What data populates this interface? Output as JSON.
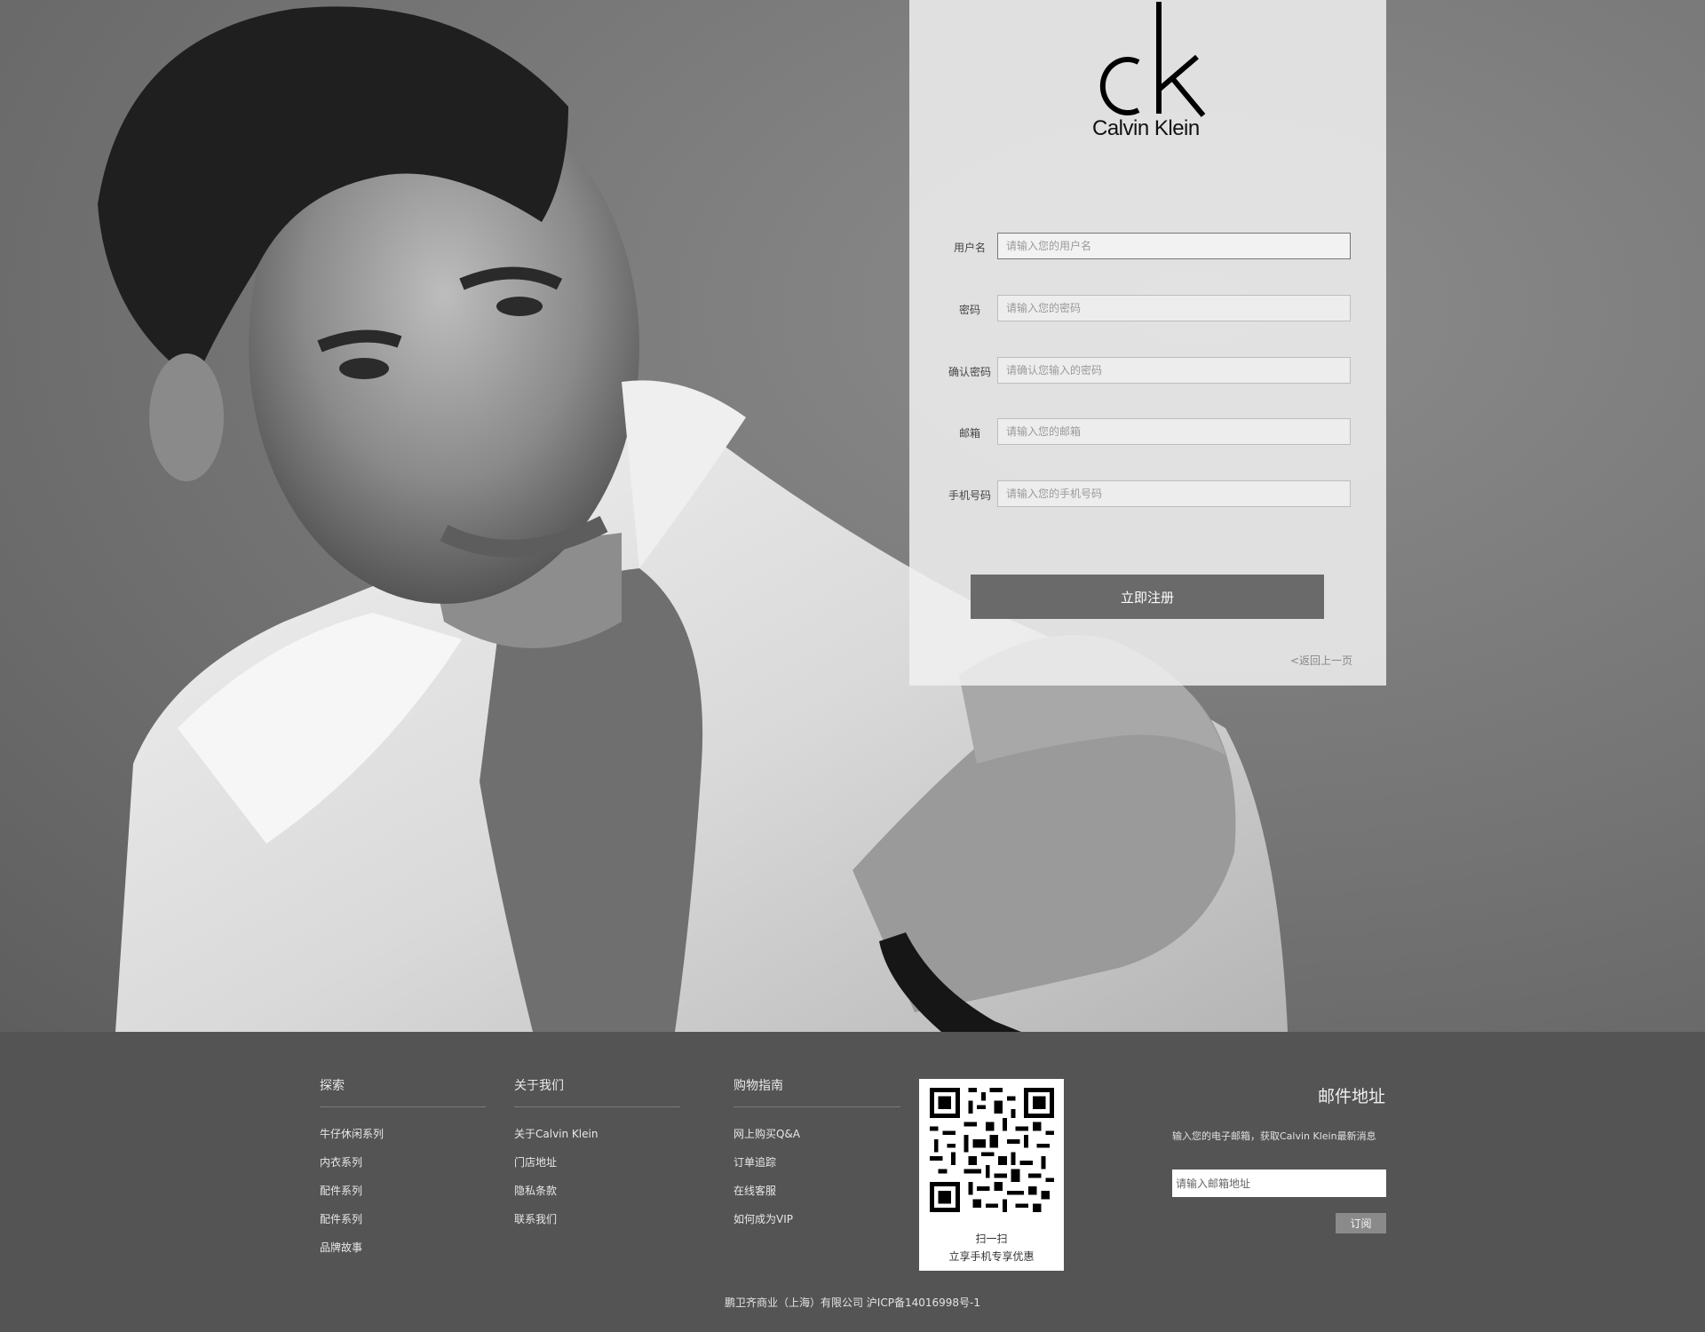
{
  "brand": {
    "logo_mark": "ck",
    "logo_text": "Calvin Klein"
  },
  "form": {
    "fields": [
      {
        "label": "用户名",
        "placeholder": "请输入您的用户名"
      },
      {
        "label": "密码",
        "placeholder": "请输入您的密码"
      },
      {
        "label": "确认密码",
        "placeholder": "请确认您输入的密码"
      },
      {
        "label": "邮箱",
        "placeholder": "请输入您的邮箱"
      },
      {
        "label": "手机号码",
        "placeholder": "请输入您的手机号码"
      }
    ],
    "submit_label": "立即注册",
    "back_label": "<返回上一页"
  },
  "footer": {
    "columns": [
      {
        "title": "探索",
        "items": [
          "牛仔休闲系列",
          "内衣系列",
          "配件系列",
          "配件系列",
          "品牌故事"
        ]
      },
      {
        "title": "关于我们",
        "items": [
          "关于Calvin Klein",
          "门店地址",
          "隐私条款",
          "联系我们"
        ]
      },
      {
        "title": "购物指南",
        "items": [
          "网上购买Q&A",
          "订单追踪",
          "在线客服",
          "如何成为VIP"
        ]
      }
    ],
    "qr": {
      "line1": "扫一扫",
      "line2": "立享手机专享优惠"
    },
    "newsletter": {
      "title": "邮件地址",
      "description": "输入您的电子邮箱，获取Calvin Klein最新消息",
      "placeholder": "请输入邮箱地址",
      "button_label": "订阅"
    },
    "copyright": "鹏卫齐商业（上海）有限公司 沪ICP备14016998号-1"
  },
  "colors": {
    "panel_bg": "#f0f0f0",
    "button_bg": "#6a6a6a",
    "footer_bg": "#545454"
  }
}
